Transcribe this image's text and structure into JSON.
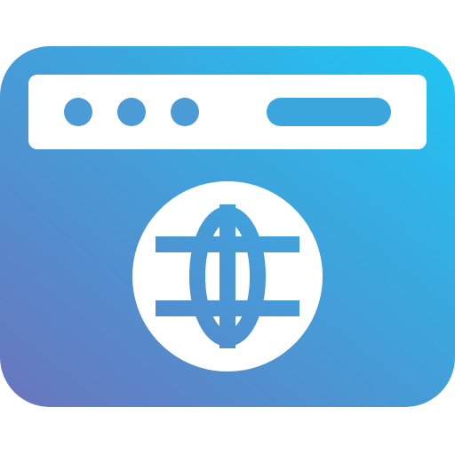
{
  "icon": {
    "name": "browser-globe-icon",
    "gradient": {
      "start": "#6a75bd",
      "end": "#1ec6f4"
    },
    "foreground": "#ffffff"
  }
}
